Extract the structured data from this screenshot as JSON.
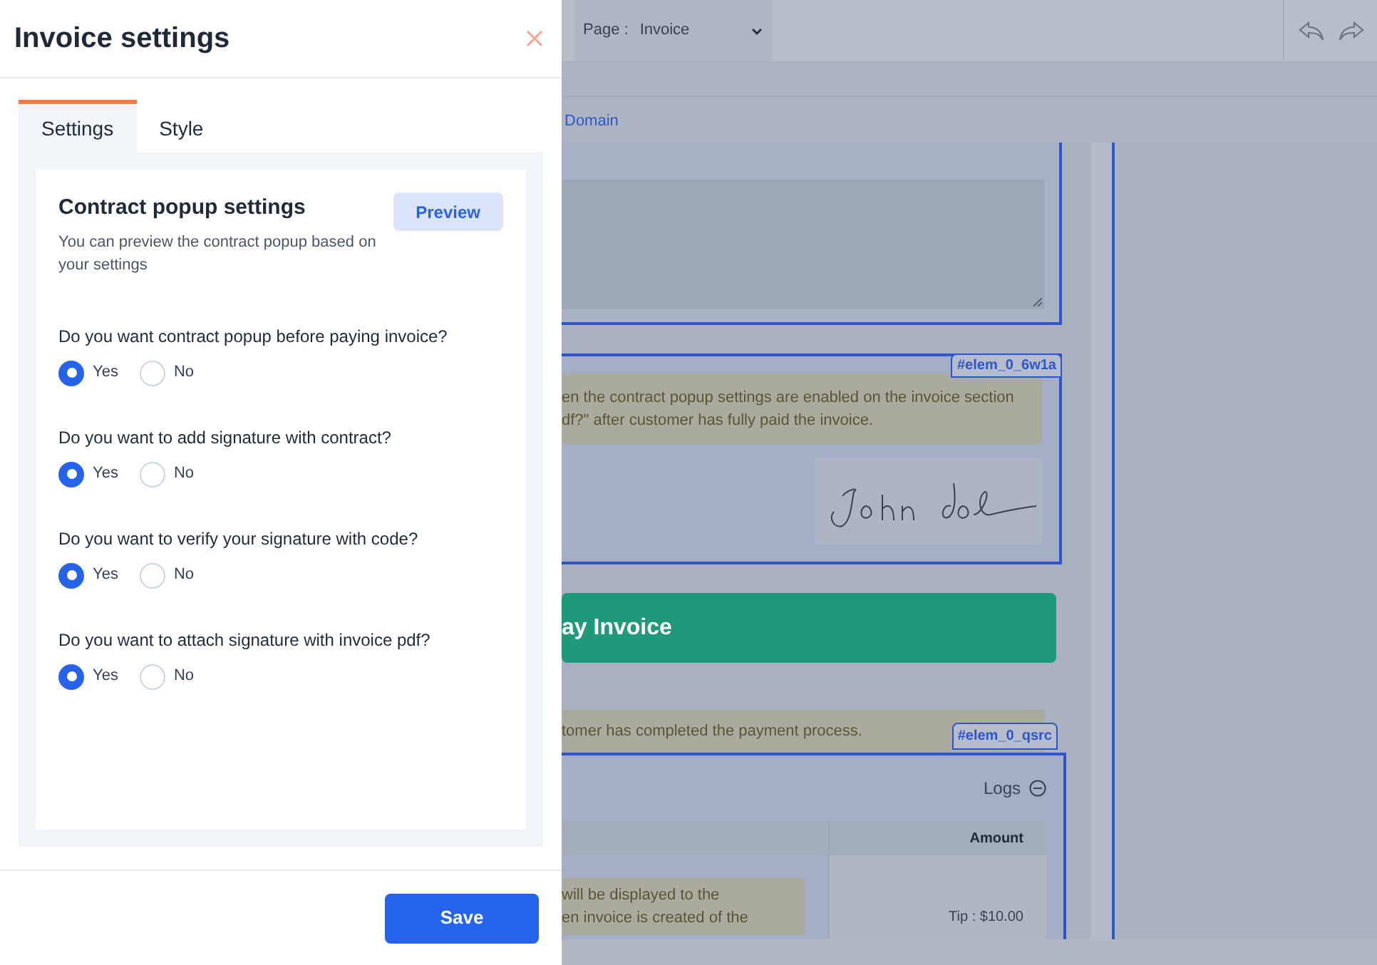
{
  "panel": {
    "title": "Invoice settings",
    "tabs": [
      {
        "label": "Settings",
        "selected": true
      },
      {
        "label": "Style",
        "selected": false
      }
    ],
    "section": {
      "title": "Contract popup settings",
      "description": "You can preview the contract popup based on your settings",
      "preview_button": "Preview"
    },
    "questions": [
      {
        "label": "Do you want contract popup before paying invoice?",
        "options": [
          {
            "label": "Yes",
            "selected": true
          },
          {
            "label": "No",
            "selected": false
          }
        ]
      },
      {
        "label": "Do you want to add signature with contract?",
        "options": [
          {
            "label": "Yes",
            "selected": true
          },
          {
            "label": "No",
            "selected": false
          }
        ]
      },
      {
        "label": "Do you want to verify your signature with code?",
        "options": [
          {
            "label": "Yes",
            "selected": true
          },
          {
            "label": "No",
            "selected": false
          }
        ]
      },
      {
        "label": "Do you want to attach signature with invoice pdf?",
        "options": [
          {
            "label": "Yes",
            "selected": true
          },
          {
            "label": "No",
            "selected": false
          }
        ]
      }
    ],
    "save_button": "Save"
  },
  "background": {
    "page_label": "Page :",
    "page_value": "Invoice",
    "domain_link": "Domain",
    "element_tag_1": "#elem_0_6w1a",
    "note_1": [
      "en the contract popup settings are enabled on the invoice section",
      "df?\" after customer has fully paid the invoice."
    ],
    "pay_button": "ay Invoice",
    "note_2": "tomer has completed the payment process.",
    "element_tag_2": "#elem_0_qsrc",
    "logs_label": "Logs",
    "amount_header": "Amount",
    "note_3": [
      "will be displayed to the",
      "en invoice is created of the"
    ],
    "tip": "Tip : $10.00"
  }
}
